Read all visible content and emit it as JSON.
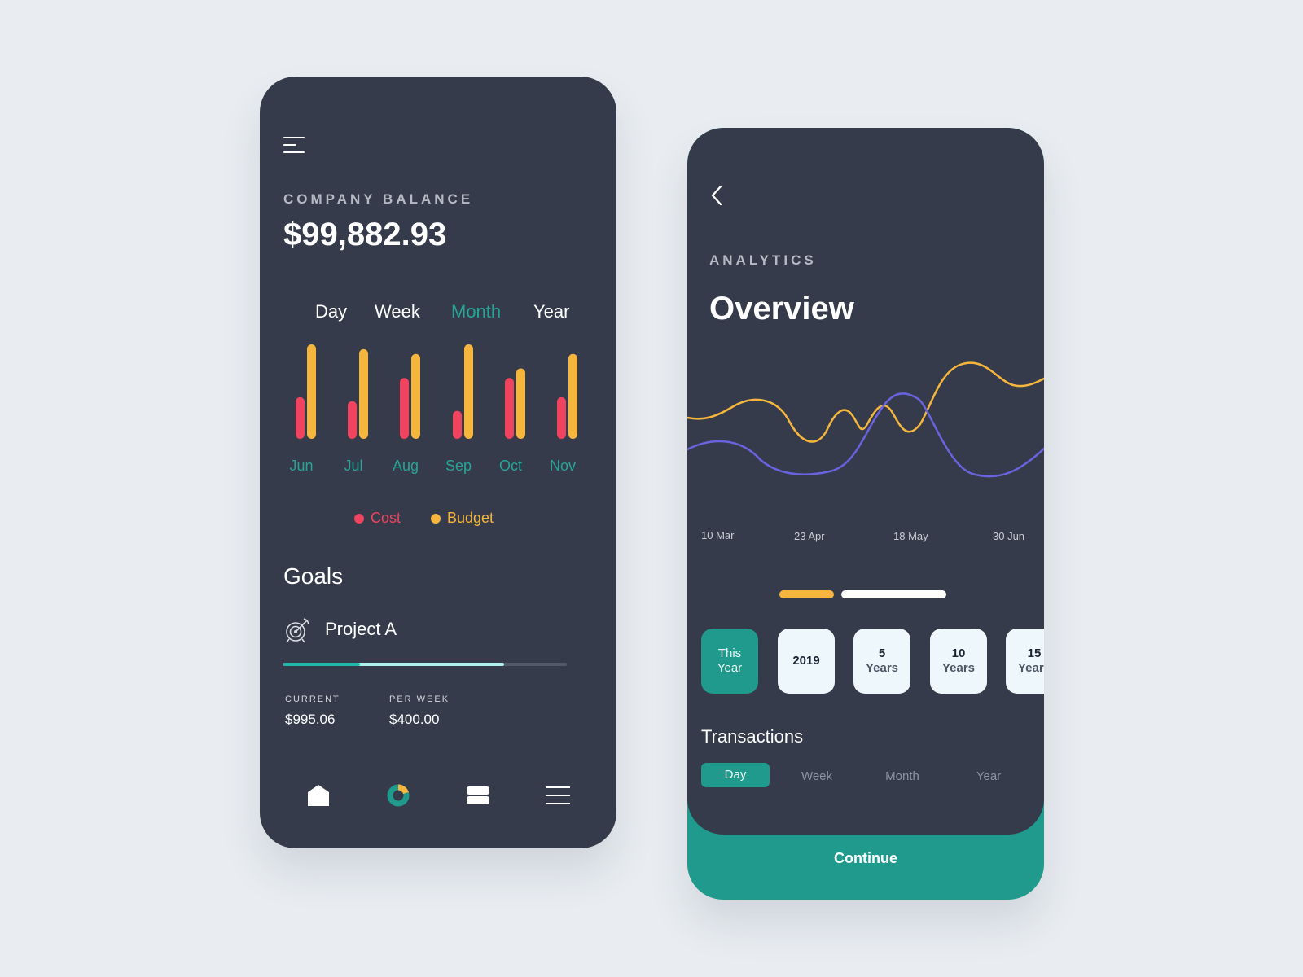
{
  "balance_screen": {
    "eyebrow": "COMPANY BALANCE",
    "balance": "$99,882.93",
    "period_tabs": [
      {
        "label": "Day",
        "active": false
      },
      {
        "label": "Week",
        "active": false
      },
      {
        "label": "Month",
        "active": true
      },
      {
        "label": "Year",
        "active": false
      }
    ],
    "chart_data": {
      "type": "bar",
      "categories": [
        "Jun",
        "Jul",
        "Aug",
        "Sep",
        "Oct",
        "Nov"
      ],
      "series": [
        {
          "name": "Cost",
          "color": "#f0435f",
          "values": [
            52,
            47,
            76,
            35,
            76,
            52
          ]
        },
        {
          "name": "Budget",
          "color": "#f6b63e",
          "values": [
            118,
            112,
            106,
            118,
            88,
            106
          ]
        }
      ],
      "ylim": [
        0,
        120
      ],
      "legend": "bottom"
    },
    "goals": {
      "title": "Goals",
      "project": "Project A",
      "icon": "target-icon",
      "progress_current": 0.27,
      "progress_projected": 0.78,
      "current_label": "CURRENT",
      "current_value": "$995.06",
      "per_week_label": "PER WEEK",
      "per_week_value": "$400.00"
    },
    "nav": [
      "home-icon",
      "pie-chart-icon",
      "card-icon",
      "menu-icon"
    ],
    "colors": {
      "accent": "#26a597",
      "cost": "#f0435f",
      "budget": "#f6b63e",
      "panel": "#353b4a"
    }
  },
  "analytics_screen": {
    "eyebrow": "ANALYTICS",
    "title": "Overview",
    "dates": [
      "10 Mar",
      "23 Apr",
      "18 May",
      "30 Jun"
    ],
    "chips": [
      {
        "line1": "This",
        "line2": "Year",
        "active": true
      },
      {
        "line1": "2019",
        "line2": "",
        "active": false
      },
      {
        "line1": "5",
        "line2": "Years",
        "active": false
      },
      {
        "line1": "10",
        "line2": "Years",
        "active": false
      },
      {
        "line1": "15",
        "line2": "Years",
        "active": false
      }
    ],
    "transactions_title": "Transactions",
    "transaction_tabs": [
      {
        "label": "Day",
        "active": true
      },
      {
        "label": "Week",
        "active": false
      },
      {
        "label": "Month",
        "active": false
      },
      {
        "label": "Year",
        "active": false
      }
    ],
    "continue_label": "Continue",
    "line_colors": {
      "gold": "#f6b63e",
      "purple": "#6a63df"
    }
  }
}
